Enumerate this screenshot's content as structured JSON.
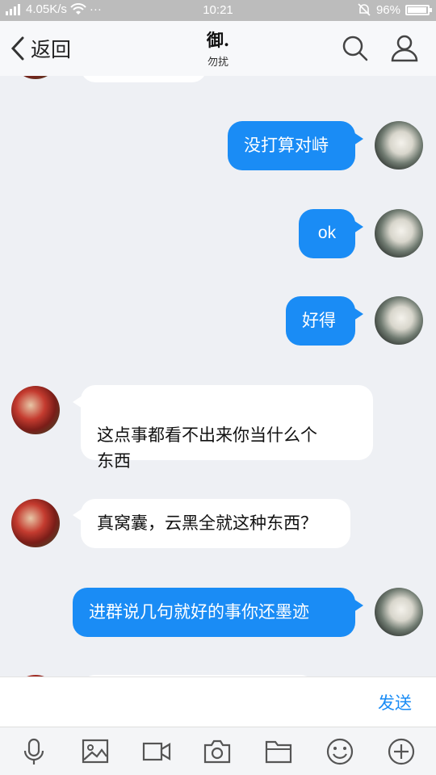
{
  "status_bar": {
    "network": "4.05K/s",
    "dots": "···",
    "time": "10:21",
    "battery": "96%",
    "battery_level": 0.96
  },
  "header": {
    "back_label": "返回",
    "title": "御.",
    "subtitle": "勿扰"
  },
  "messages": [
    {
      "from": "self",
      "text": "没打算对峙"
    },
    {
      "from": "self",
      "text": "ok"
    },
    {
      "from": "self",
      "text": "好得"
    },
    {
      "from": "peer",
      "text": "这点事都看不出来你当什么个\n东西"
    },
    {
      "from": "peer",
      "text": "真窝囊，云黑全就这种东西？"
    },
    {
      "from": "self",
      "text": "进群说几句就好的事你还墨迹"
    }
  ],
  "input": {
    "value": "",
    "send_label": "发送"
  },
  "toolbar": {
    "icons": [
      "microphone-icon",
      "image-icon",
      "video-icon",
      "camera-icon",
      "folder-icon",
      "emoji-icon",
      "plus-icon"
    ]
  },
  "colors": {
    "accent": "#1a8cf5",
    "background": "#eef0f4",
    "status_bar": "#bcbcbc"
  }
}
